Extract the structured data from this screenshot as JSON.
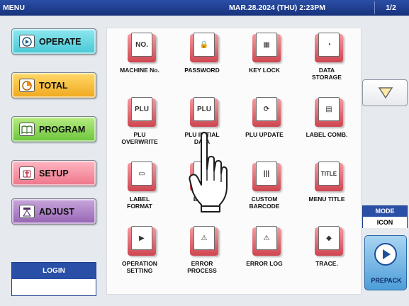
{
  "header": {
    "menu_title": "MENU",
    "datetime": "MAR.28.2024 (THU)  2:23PM",
    "page": "1/2"
  },
  "left_nav": [
    {
      "id": "operate",
      "label": "OPERATE",
      "icon": "play-icon"
    },
    {
      "id": "total",
      "label": "TOTAL",
      "icon": "timer-icon"
    },
    {
      "id": "program",
      "label": "PROGRAM",
      "icon": "book-icon"
    },
    {
      "id": "setup",
      "label": "SETUP",
      "icon": "wrench-icon"
    },
    {
      "id": "adjust",
      "label": "ADJUST",
      "icon": "scale-icon"
    }
  ],
  "login": {
    "label": "LOGIN",
    "value": ""
  },
  "menu_items": [
    {
      "label": "MACHINE No.",
      "icon": "machine-number-icon",
      "glyph": "NO."
    },
    {
      "label": "PASSWORD",
      "icon": "lock-icon",
      "glyph": "🔒"
    },
    {
      "label": "KEY LOCK",
      "icon": "key-grid-icon",
      "glyph": "▦"
    },
    {
      "label": "DATA\nSTORAGE",
      "icon": "data-storage-icon",
      "glyph": "◔"
    },
    {
      "label": "PLU\nOVERWRITE",
      "icon": "plu-overwrite-icon",
      "glyph": "PLU"
    },
    {
      "label": "PLU INITIAL\nDATA",
      "icon": "plu-initial-icon",
      "glyph": "PLU"
    },
    {
      "label": "PLU UPDATE",
      "icon": "plu-update-icon",
      "glyph": "⟳"
    },
    {
      "label": "LABEL COMB.",
      "icon": "label-comb-icon",
      "glyph": "▤"
    },
    {
      "label": "LABEL\nFORMAT",
      "icon": "label-format-icon",
      "glyph": "▭"
    },
    {
      "label": "BARC",
      "icon": "barcode-icon",
      "glyph": "|||"
    },
    {
      "label": "CUSTOM\nBARCODE",
      "icon": "custom-barcode-icon",
      "glyph": "|||"
    },
    {
      "label": "MENU TITLE",
      "icon": "menu-title-icon",
      "glyph": "TITLE"
    },
    {
      "label": "OPERATION\nSETTING",
      "icon": "operation-setting-icon",
      "glyph": "▶"
    },
    {
      "label": "ERROR\nPROCESS",
      "icon": "warning-icon",
      "glyph": "⚠"
    },
    {
      "label": "ERROR LOG",
      "icon": "error-log-icon",
      "glyph": "⚠"
    },
    {
      "label": "TRACE.",
      "icon": "trace-icon",
      "glyph": "◆"
    }
  ],
  "mode": {
    "label": "MODE",
    "value": "ICON"
  },
  "prepack": {
    "label": "PREPACK"
  }
}
